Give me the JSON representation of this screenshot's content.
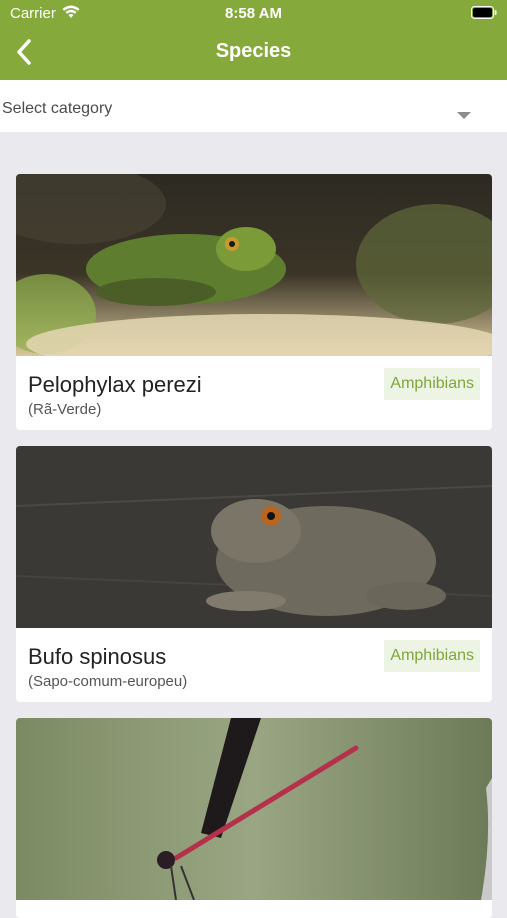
{
  "status": {
    "carrier": "Carrier",
    "time": "8:58 AM"
  },
  "nav": {
    "title": "Species"
  },
  "filter": {
    "placeholder": "Select category"
  },
  "species": [
    {
      "name": "Pelophylax perezi",
      "common": "(Rã-Verde)",
      "category": "Amphibians"
    },
    {
      "name": "Bufo spinosus",
      "common": "(Sapo-comum-europeu)",
      "category": "Amphibians"
    },
    {
      "name": "",
      "common": "",
      "category": ""
    }
  ],
  "colors": {
    "accent": "#86a93c",
    "badge_bg": "#edf4e3",
    "badge_text": "#7fa63a",
    "background": "#e9e9ee"
  },
  "icons": {
    "back": "chevron-left-icon",
    "wifi": "wifi-icon",
    "battery": "battery-icon",
    "dropdown": "caret-down-icon"
  }
}
